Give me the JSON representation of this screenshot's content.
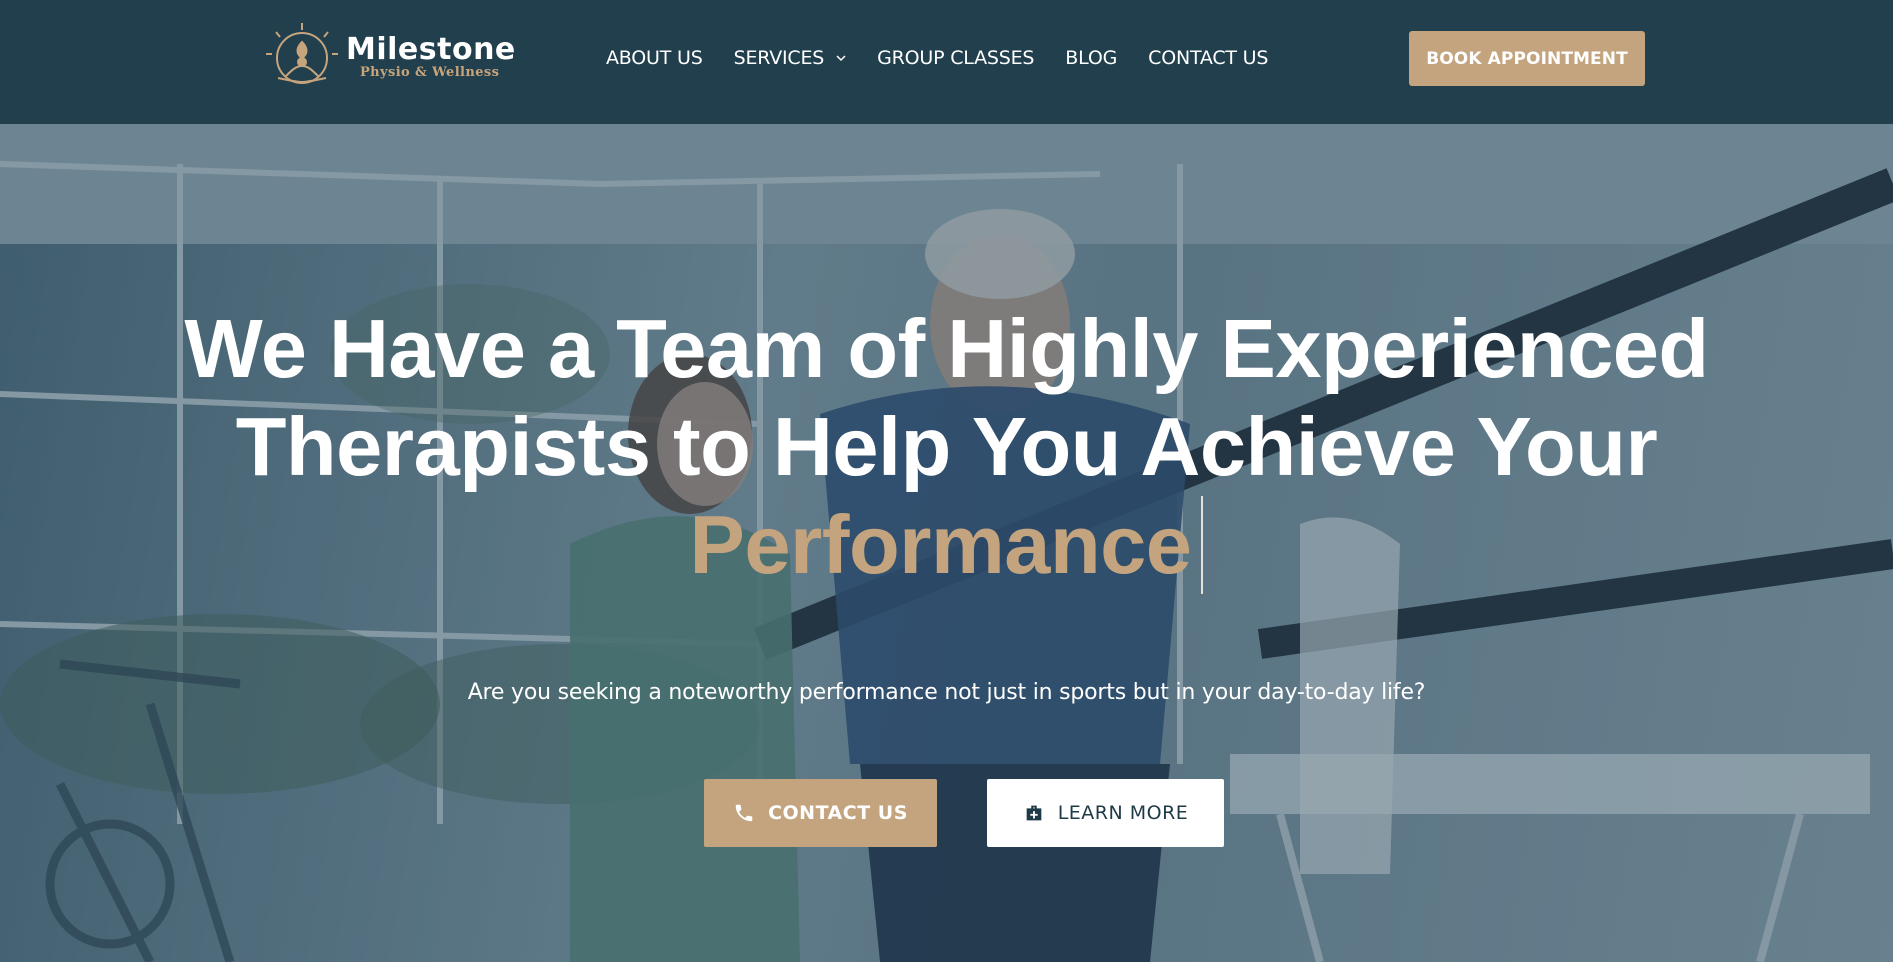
{
  "brand": {
    "name": "Milestone",
    "tagline": "Physio & Wellness",
    "logo_icon": "lotus-meditation-sun-icon",
    "primary_color": "#223f4e",
    "accent_color": "#c4a47e"
  },
  "nav": {
    "items": [
      {
        "label": "ABOUT US"
      },
      {
        "label": "SERVICES",
        "has_dropdown": true
      },
      {
        "label": "GROUP CLASSES"
      },
      {
        "label": "BLOG"
      },
      {
        "label": "CONTACT US"
      }
    ],
    "book_button": "BOOK APPOINTMENT"
  },
  "hero": {
    "headline_line1": "We Have a Team of Highly Experienced",
    "headline_line2": "Therapists to Help You Achieve Your",
    "headline_accent": "Performance",
    "subtext": "Are you seeking a noteworthy performance not just in sports but in your day-to-day life?",
    "cta_primary": {
      "label": "CONTACT US",
      "icon": "phone-icon"
    },
    "cta_secondary": {
      "label": "LEARN MORE",
      "icon": "medical-kit-icon"
    }
  }
}
